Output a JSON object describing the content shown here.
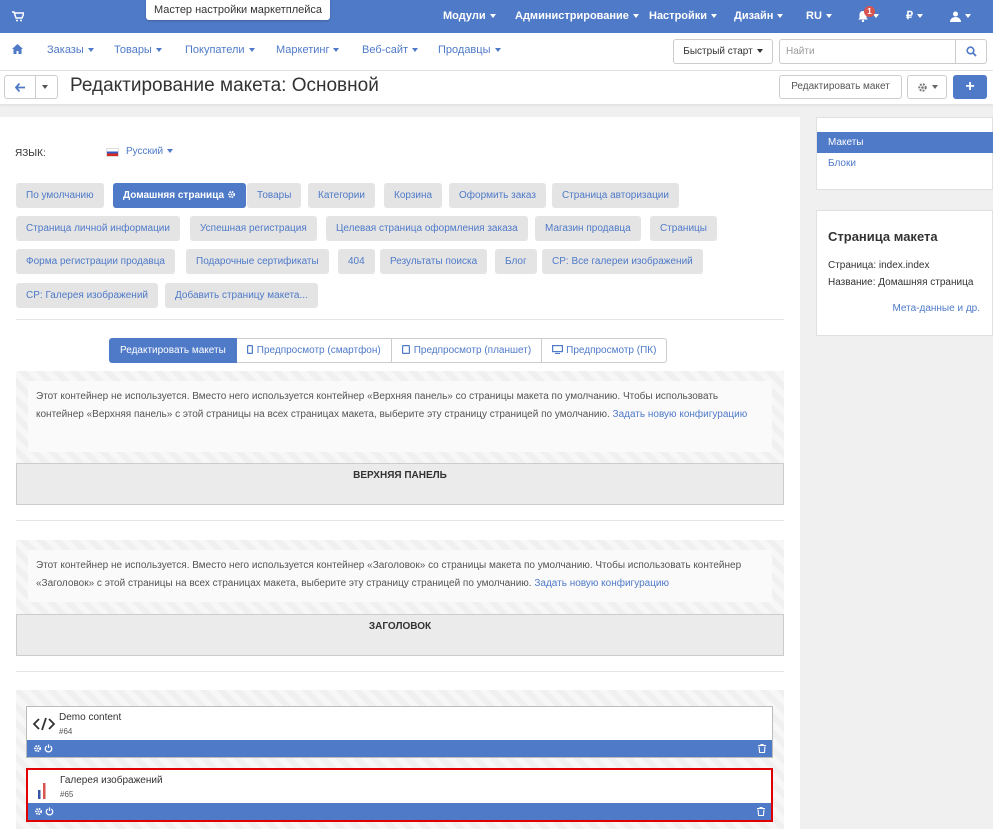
{
  "topbar": {
    "wizard_label": "Мастер настройки маркетплейса",
    "nav": [
      "Модули",
      "Администрирование",
      "Настройки",
      "Дизайн",
      "RU"
    ],
    "notifications_count": "1",
    "currency": "₽"
  },
  "menubar": {
    "items": [
      "Заказы",
      "Товары",
      "Покупатели",
      "Маркетинг",
      "Веб-сайт",
      "Продавцы"
    ],
    "quick_start": "Быстрый старт",
    "search_placeholder": "Найти"
  },
  "subbar": {
    "title": "Редактирование макета: Основной",
    "edit_layout": "Редактировать макет"
  },
  "main": {
    "language_label": "ЯЗЫК:",
    "language_value": "Русский",
    "page_tabs": [
      "По умолчанию",
      "Домашняя страница",
      "Товары",
      "Категории",
      "Корзина",
      "Оформить заказ",
      "Страница авторизации",
      "Страница личной информации",
      "Успешная регистрация",
      "Целевая страница оформления заказа",
      "Магазин продавца",
      "Страницы",
      "Форма регистрации продавца",
      "Подарочные сертификаты",
      "404",
      "Результаты поиска",
      "Блог",
      "CP: Все галереи изображений",
      "CP: Галерея изображений",
      "Добавить страницу макета..."
    ],
    "active_page_tab": "Домашняя страница",
    "view_tabs": [
      "Редактировать макеты",
      "Предпросмотр (смартфон)",
      "Предпросмотр (планшет)",
      "Предпросмотр (ПК)"
    ],
    "containers": [
      {
        "notice_text": "Этот контейнер не используется. Вместо него используется контейнер «Верхняя панель» со страницы макета по умолчанию. Чтобы использовать контейнер «Верхняя панель» с этой страницы на всех страницах макета, выберите эту страницу страницей по умолчанию.",
        "notice_link": "Задать новую конфигурацию",
        "title": "ВЕРХНЯЯ ПАНЕЛЬ"
      },
      {
        "notice_text": "Этот контейнер не используется. Вместо него используется контейнер «Заголовок» со страницы макета по умолчанию. Чтобы использовать контейнер «Заголовок» с этой страницы на всех страницах макета, выберите эту страницу страницей по умолчанию.",
        "notice_link": "Задать новую конфигурацию",
        "title": "ЗАГОЛОВОК"
      }
    ],
    "blocks": [
      {
        "title": "Demo content",
        "id": "#64"
      },
      {
        "title": "Галерея изображений",
        "id": "#65"
      }
    ]
  },
  "sidebar": {
    "items": [
      "Макеты",
      "Блоки"
    ],
    "info_title": "Страница макета",
    "page_line": "Страница: index.index",
    "name_line": "Название: Домашняя страница",
    "meta_link": "Мета-данные и др."
  },
  "colors": {
    "accent": "#4f7ac8",
    "highlight": "#e00000"
  }
}
